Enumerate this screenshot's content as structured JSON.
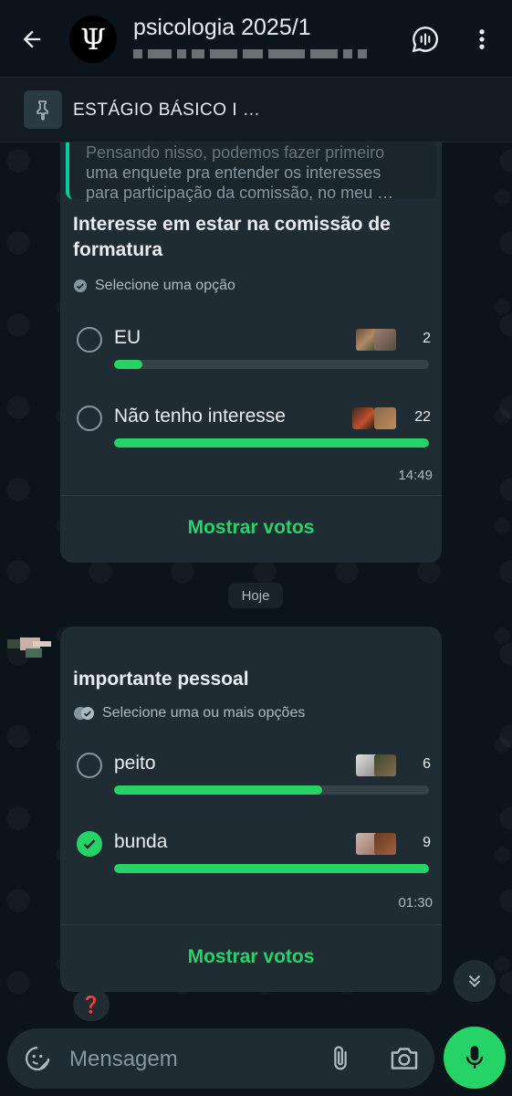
{
  "header": {
    "title": "psicologia 2025/1",
    "avatar_glyph": "Ψ"
  },
  "pinned": {
    "text": "ESTÁGIO BÁSICO I …"
  },
  "poll1": {
    "quote_lines": [
      "Pensando nisso, podemos fazer primeiro",
      "uma enquete pra entender os interesses",
      "para participação da comissão, no meu …"
    ],
    "question_line1": "Interesse em estar na comissão de",
    "question_line2": "formatura",
    "subtitle": "Selecione uma opção",
    "options": [
      {
        "label": "EU",
        "count": "2",
        "fraction": 0.09
      },
      {
        "label": "Não tenho interesse",
        "count": "22",
        "fraction": 1.0
      }
    ],
    "time": "14:49",
    "show_votes": "Mostrar votos"
  },
  "date_chip": "Hoje",
  "poll2": {
    "question": "importante pessoal",
    "subtitle": "Selecione uma ou mais opções",
    "options": [
      {
        "label": "peito",
        "count": "6",
        "fraction": 0.66,
        "checked": false
      },
      {
        "label": "bunda",
        "count": "9",
        "fraction": 1.0,
        "checked": true
      }
    ],
    "time": "01:30",
    "show_votes": "Mostrar votos"
  },
  "reaction": "❓",
  "composer": {
    "placeholder": "Mensagem"
  },
  "colors": {
    "accent": "#25d366",
    "background": "#0b141a",
    "bubble": "#202c33"
  }
}
